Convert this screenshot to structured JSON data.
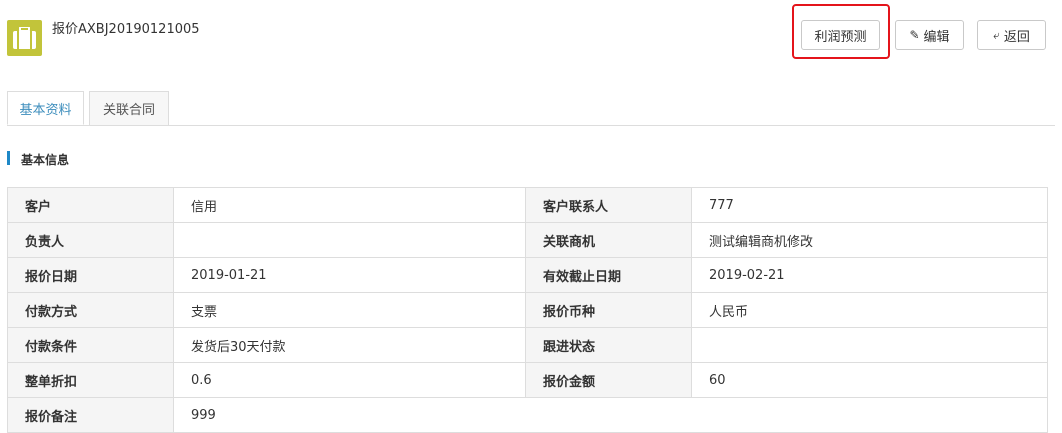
{
  "header": {
    "title": "报价AXBJ20190121005",
    "buttons": {
      "profit_label": "利润预测",
      "edit_label": "编辑",
      "back_label": "返回"
    }
  },
  "tabs": [
    {
      "label": "基本资料",
      "active": true
    },
    {
      "label": "关联合同",
      "active": false
    }
  ],
  "section": {
    "title": "基本信息"
  },
  "rows": [
    {
      "l1": "客户",
      "v1": "信用",
      "l2": "客户联系人",
      "v2": "777"
    },
    {
      "l1": "负责人",
      "v1": "",
      "l2": "关联商机",
      "v2": "测试编辑商机修改"
    },
    {
      "l1": "报价日期",
      "v1": "2019-01-21",
      "l2": "有效截止日期",
      "v2": "2019-02-21"
    },
    {
      "l1": "付款方式",
      "v1": "支票",
      "l2": "报价币种",
      "v2": "人民币"
    },
    {
      "l1": "付款条件",
      "v1": "发货后30天付款",
      "l2": "跟进状态",
      "v2": ""
    },
    {
      "l1": "整单折扣",
      "v1": "0.6",
      "l2": "报价金额",
      "v2": "60"
    },
    {
      "l1": "报价备注",
      "v1": "999"
    }
  ],
  "colors": {
    "accent": "#3c8dbc",
    "section_bar": "#1e88c7",
    "icon_bg": "#c2c43a",
    "highlight": "#e4141b"
  }
}
